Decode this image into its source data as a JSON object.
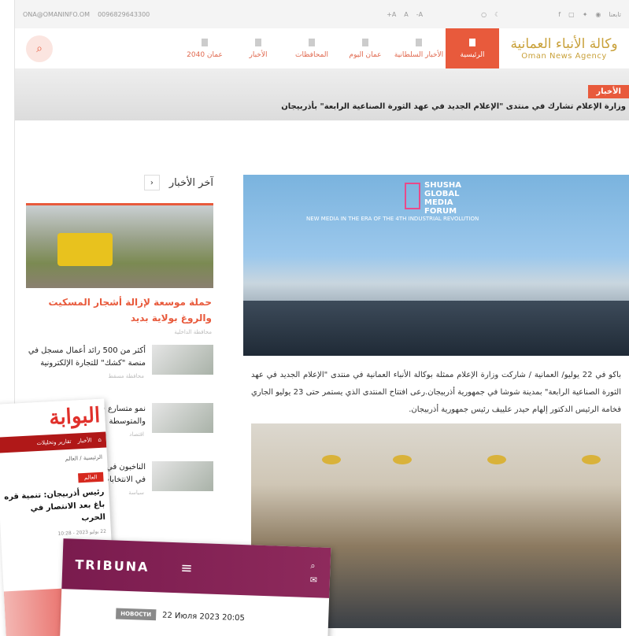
{
  "topbar": {
    "social_label": "تابعنا",
    "phone": "0096829643300",
    "email": "ONA@OMANINFO.OM",
    "font_controls": [
      "A-",
      "A",
      "A+"
    ]
  },
  "brand": {
    "ar": "وكالة الأنباء العمانية",
    "en": "Oman News Agency"
  },
  "nav": [
    {
      "label": "الرئيسية"
    },
    {
      "label": "الأخبار السلطانية"
    },
    {
      "label": "عمان اليوم"
    },
    {
      "label": "المحافظات"
    },
    {
      "label": "الأخبار"
    },
    {
      "label": "عمان 2040"
    }
  ],
  "ticker": {
    "label": "الأخبار",
    "text": "وزارة الإعلام تشارك في منتدى \"الإعلام الجديد في عهد الثورة الصناعية الرابعة\" بأذربيجان"
  },
  "article": {
    "forum": "SHUSHA GLOBAL MEDIA FORUM",
    "tagline": "NEW MEDIA IN THE ERA OF THE 4TH INDUSTRIAL REVOLUTION",
    "body": "باكو في 22 يوليو/ العمانية / شاركت وزارة الإعلام ممثلة بوكالة الأنباء العمانية في منتدى \"الإعلام الجديد في عهد الثورة الصناعية الرابعة\" بمدينة شوشا في جمهورية أذربيجان.رعى افتتاح المنتدى الذي يستمر حتى 23 يوليو الجاري فخامة الرئيس الدكتور إلهام حيدر علييف رئيس جمهورية أذربيجان."
  },
  "sidebar": {
    "heading": "آخر الأخبار",
    "main_title": "حملة موسعة لإزالة أشجار المسكيت والروغ بولاية بديد",
    "main_meta": "محافظة الداخلية",
    "items": [
      {
        "title": "أكثر من 500 رائد أعمال مسجل في منصة \"كشك\" للتجارة الإلكترونية",
        "meta": "محافظة مسقط"
      },
      {
        "title": "نمو متسارع في المؤسسات الصغيرة والمتوسطة",
        "meta": "اقتصاد"
      },
      {
        "title": "الناخبون في كمبوديا يدلون بأصواتهم في الانتخابات",
        "meta": "سياسة"
      }
    ]
  },
  "clip1": {
    "logo": "البوابة",
    "menu": [
      "الأخبار",
      "تقارير وتحليلات"
    ],
    "crumb": "الرئيسية / العالم",
    "category": "العالم",
    "headline": "رئيس أذربيجان: تنمية قره باغ بعد الانتصار في الحرب",
    "date": "22 يوليو 2023 - 10:28"
  },
  "clip2": {
    "logo": "TRIBUNA",
    "badge": "НОВОСТИ",
    "date": "22 Июля 2023 20:05"
  }
}
